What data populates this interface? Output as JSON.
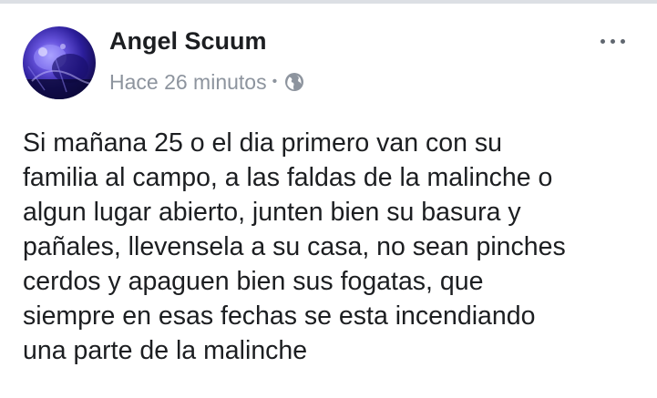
{
  "post": {
    "author": "Angel Scuum",
    "timestamp": "Hace 26 minutos",
    "separator": "•",
    "privacy_icon": "globe-icon",
    "more_icon": "more-horizontal-icon",
    "text": "Si mañana 25 o el dia primero van con su\nfamilia al campo, a las faldas de la malinche o\nalgun lugar abierto, junten bien su basura y\npañales, llevensela a su casa, no sean pinches\ncerdos y apaguen bien sus fogatas, que\nsiempre en esas fechas se esta incendiando\nuna parte de la malinche"
  },
  "colors": {
    "text_primary": "#1c1e21",
    "text_secondary": "#8d949e",
    "icon_gray": "#606770",
    "divider": "#dcdfe4",
    "avatar_blue": "#2b1d9a"
  }
}
